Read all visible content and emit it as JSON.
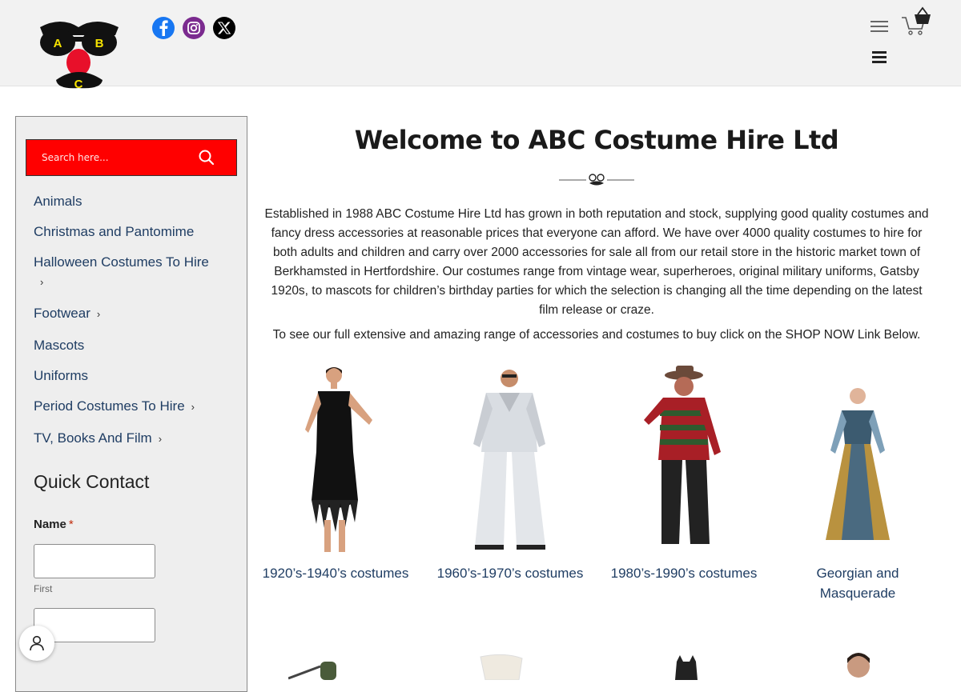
{
  "header": {
    "logo_letters": [
      "A",
      "B",
      "C"
    ],
    "social_icons": [
      "facebook-icon",
      "instagram-icon",
      "x-twitter-icon"
    ],
    "colors": {
      "facebook": "#1877f2",
      "instagram": "#7b2b8f",
      "x": "#000000",
      "background": "#f2f2f2"
    }
  },
  "sidebar": {
    "search": {
      "placeholder": "Search here..."
    },
    "categories": [
      {
        "label": "Animals",
        "has_submenu": false
      },
      {
        "label": "Christmas and Pantomime",
        "has_submenu": false
      },
      {
        "label": "Halloween Costumes To Hire",
        "has_submenu": true
      },
      {
        "label": "Footwear",
        "has_submenu": true
      },
      {
        "label": "Mascots",
        "has_submenu": false
      },
      {
        "label": "Uniforms",
        "has_submenu": false
      },
      {
        "label": "Period Costumes To Hire",
        "has_submenu": true
      },
      {
        "label": "TV, Books And Film",
        "has_submenu": true
      }
    ],
    "quick_contact": {
      "title": "Quick Contact",
      "name_label": "Name",
      "required_mark": "*",
      "first_label": "First"
    }
  },
  "main": {
    "title": "Welcome to ABC Costume Hire Ltd",
    "intro": "Established in 1988 ABC Costume Hire Ltd has grown in both reputation and stock, supplying good quality costumes and fancy dress accessories at reasonable prices that everyone can afford. We have over 4000 quality costumes to hire for both adults and children and carry over 2000 accessories for sale all from our retail store in the historic market town of Berkhamsted in Hertfordshire. Our costumes range from vintage wear, superheroes, original military uniforms, Gatsby 1920s, to mascots for children’s birthday parties for which the selection is changing all the time depending on the latest film release or craze.",
    "intro2": "To see our full extensive and amazing range of accessories and costumes to buy click on the SHOP NOW Link Below.",
    "products": [
      {
        "caption": "1920’s-1940’s costumes"
      },
      {
        "caption": "1960’s-1970’s costumes"
      },
      {
        "caption": "1980’s-1990’s costumes"
      },
      {
        "caption": "Georgian and Masquerade"
      }
    ]
  },
  "accent_colors": {
    "search_bg": "#ff0000",
    "link": "#1f3d63"
  }
}
